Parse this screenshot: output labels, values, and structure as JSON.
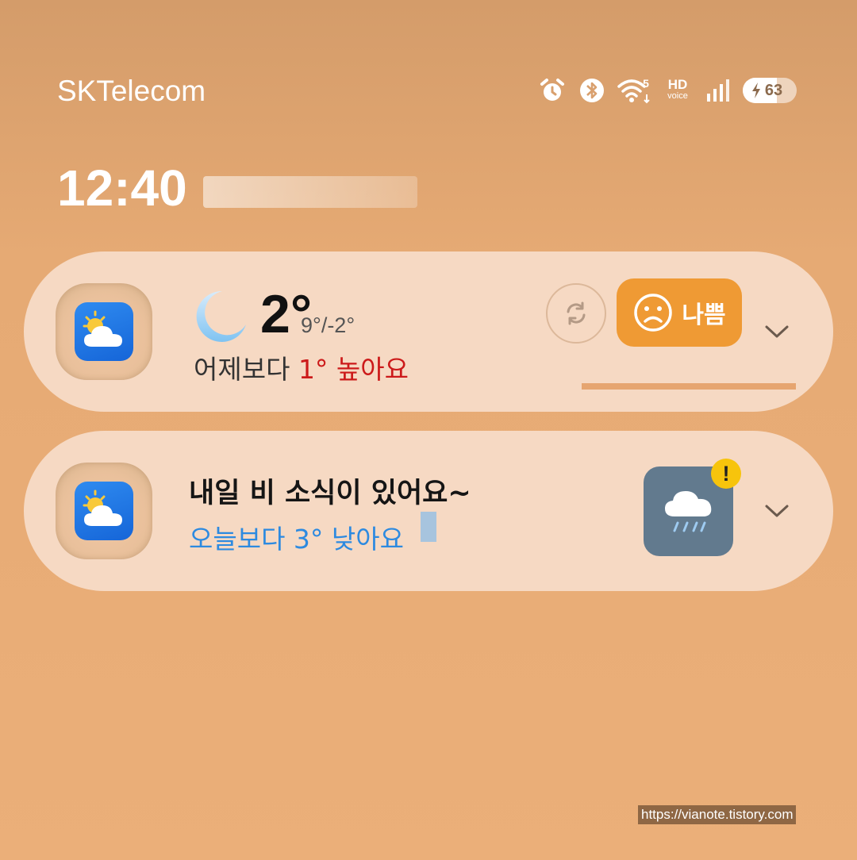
{
  "status_bar": {
    "carrier": "SKTelecom",
    "network_label": "5",
    "hd_top": "HD",
    "hd_bottom": "voice",
    "battery_level": "63",
    "icons": [
      "alarm-icon",
      "bluetooth-icon",
      "wifi-icon",
      "hd-voice-icon",
      "signal-icon",
      "battery-icon"
    ]
  },
  "lock": {
    "time": "12:40"
  },
  "weather_card": {
    "icon": "weather-app-icon",
    "condition_icon": "moon-icon",
    "temperature": "2°",
    "range": "9°/-2°",
    "compare_prefix": "어제보다 ",
    "compare_value": "1° 높아요",
    "air_quality_label": "나쁨",
    "air_quality_color": "#ef9a34",
    "compare_color": "#cc1a1a"
  },
  "forecast_card": {
    "icon": "weather-app-icon",
    "title": "내일 비 소식이 있어요~",
    "subtitle": "오늘보다 3° 낮아요",
    "subtitle_color": "#2d8ae0",
    "tile_icon": "rain-cloud-icon",
    "alert": "!"
  },
  "watermark": "https://vianote.tistory.com"
}
